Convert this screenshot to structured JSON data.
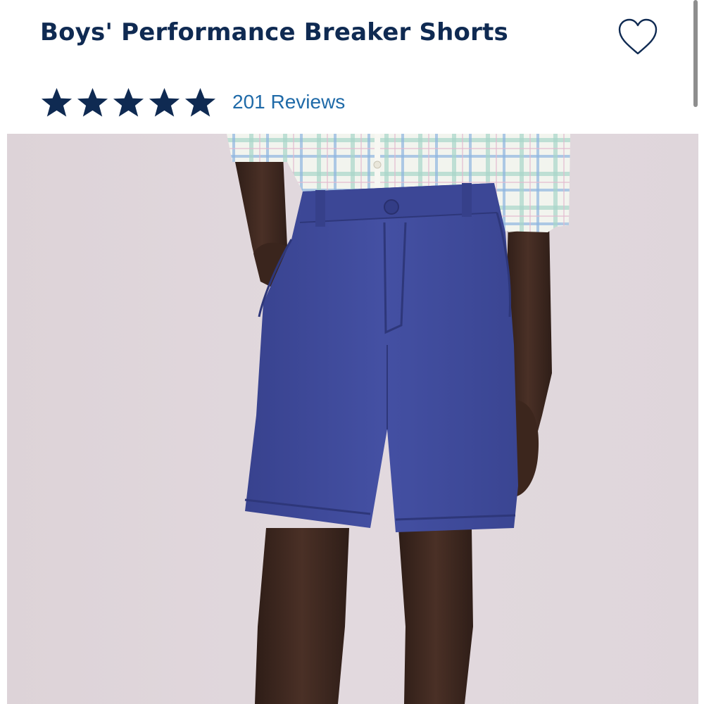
{
  "product": {
    "title": "Boys' Performance Breaker Shorts",
    "rating": {
      "stars": 5,
      "max_stars": 5,
      "reviews_label": "201 Reviews"
    },
    "favorite_icon": "heart-outline-icon",
    "image": {
      "subject": "product-photo",
      "colors": {
        "shorts": "#3f4a9b",
        "background": "#e0d7dc"
      }
    }
  },
  "theme": {
    "title_color": "#0f2a52",
    "star_color": "#0f2a52",
    "link_color": "#1f6aa8"
  }
}
